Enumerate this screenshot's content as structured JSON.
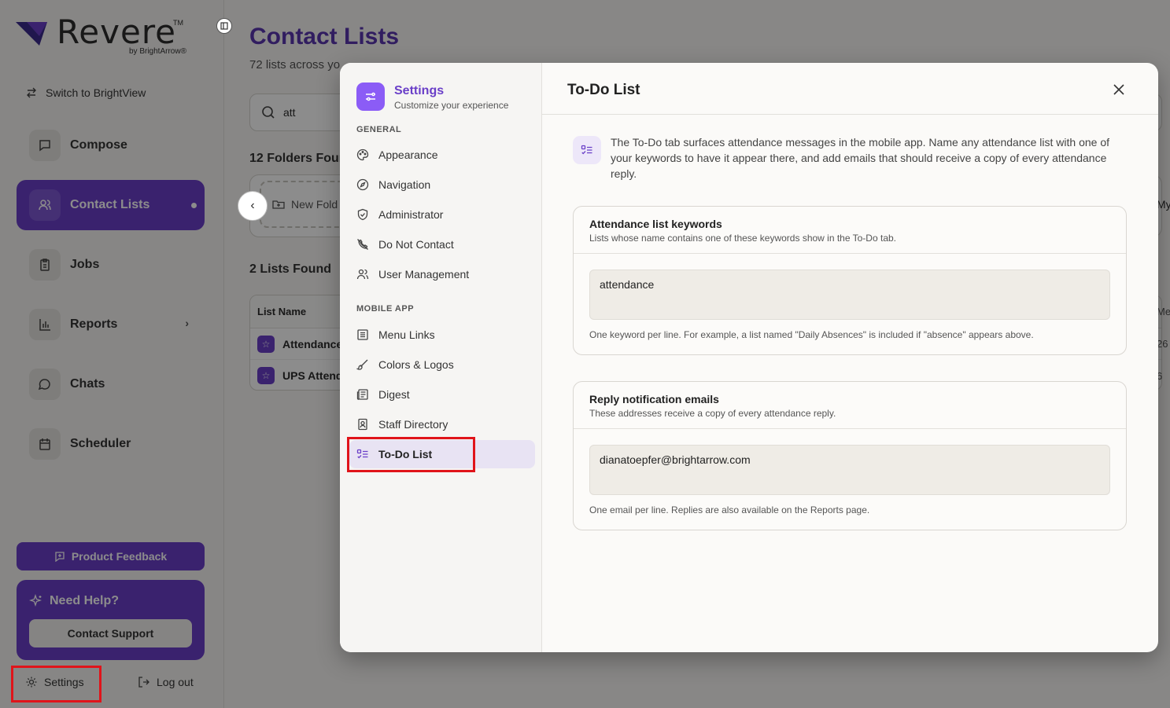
{
  "brand": {
    "name": "Revere",
    "tm": "TM",
    "by": "by BrightArrow®"
  },
  "sidebar": {
    "switch_label": "Switch to BrightView",
    "items": [
      {
        "label": "Compose"
      },
      {
        "label": "Contact Lists"
      },
      {
        "label": "Jobs"
      },
      {
        "label": "Reports"
      },
      {
        "label": "Chats"
      },
      {
        "label": "Scheduler"
      }
    ],
    "feedback_label": "Product Feedback",
    "help_title": "Need Help?",
    "help_button": "Contact Support",
    "settings_label": "Settings",
    "logout_label": "Log out"
  },
  "main": {
    "title": "Contact Lists",
    "subtitle": "72 lists across yo",
    "search_value": "att",
    "folders_found": "12 Folders Foun",
    "new_folder_label": "New Fold",
    "folder_right_partial": "My",
    "lists_found": "2 Lists Found",
    "list_col_header": "List Name",
    "col_right_header": "Mes",
    "rows": [
      {
        "name": "Attendance",
        "right": "26"
      },
      {
        "name": "UPS Attend",
        "right": "6"
      }
    ]
  },
  "settings_modal": {
    "header_title": "Settings",
    "header_subtitle": "Customize your experience",
    "general_label": "GENERAL",
    "general_items": [
      {
        "label": "Appearance"
      },
      {
        "label": "Navigation"
      },
      {
        "label": "Administrator"
      },
      {
        "label": "Do Not Contact"
      },
      {
        "label": "User Management"
      }
    ],
    "mobile_label": "MOBILE APP",
    "mobile_items": [
      {
        "label": "Menu Links"
      },
      {
        "label": "Colors & Logos"
      },
      {
        "label": "Digest"
      },
      {
        "label": "Staff Directory"
      },
      {
        "label": "To-Do List"
      }
    ],
    "panel_title": "To-Do List",
    "intro": "The To-Do tab surfaces attendance messages in the mobile app. Name any attendance list with one of your keywords to have it appear there, and add emails that should receive a copy of every attendance reply.",
    "keywords_card": {
      "title": "Attendance list keywords",
      "subtitle": "Lists whose name contains one of these keywords show in the To-Do tab.",
      "value": "attendance",
      "hint": "One keyword per line. For example, a list named \"Daily Absences\" is included if \"absence\" appears above."
    },
    "emails_card": {
      "title": "Reply notification emails",
      "subtitle": "These addresses receive a copy of every attendance reply.",
      "value": "dianatoepfer@brightarrow.com",
      "hint": "One email per line. Replies are also available on the Reports page."
    }
  },
  "colors": {
    "accent": "#6a3fc8",
    "highlight": "#e0141a"
  }
}
